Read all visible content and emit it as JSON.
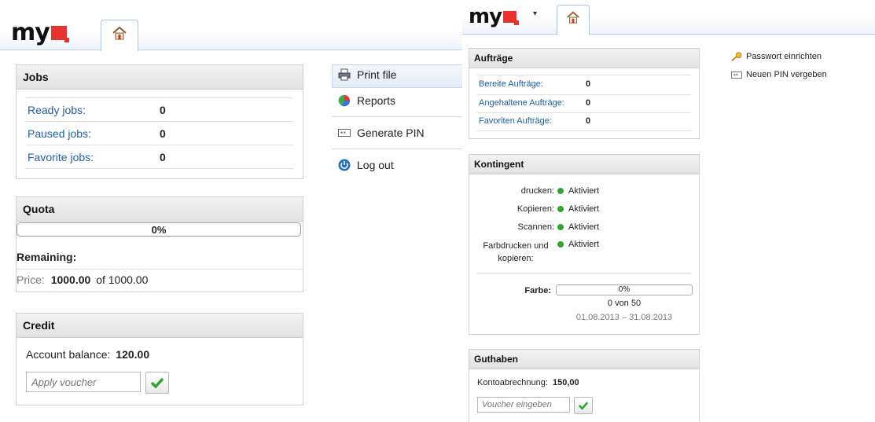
{
  "left": {
    "logo": {
      "text": "my"
    },
    "jobs": {
      "title": "Jobs",
      "rows": [
        {
          "label": "Ready jobs:",
          "value": "0"
        },
        {
          "label": "Paused jobs:",
          "value": "0"
        },
        {
          "label": "Favorite jobs:",
          "value": "0"
        }
      ]
    },
    "quota": {
      "title": "Quota",
      "progress_text": "0%",
      "progress": 0,
      "remaining_label": "Remaining:",
      "price_label": "Price:",
      "price_value": "1000.00",
      "price_of": "of 1000.00"
    },
    "credit": {
      "title": "Credit",
      "balance_label": "Account balance:",
      "balance_value": "120.00",
      "voucher_placeholder": "Apply voucher"
    },
    "menu": {
      "print_file": "Print file",
      "reports": "Reports",
      "generate_pin": "Generate PIN",
      "log_out": "Log out"
    }
  },
  "right": {
    "logo": {
      "text": "my"
    },
    "auftraege": {
      "title": "Aufträge",
      "rows": [
        {
          "label": "Bereite Aufträge:",
          "value": "0"
        },
        {
          "label": "Angehaltene Aufträge:",
          "value": "0"
        },
        {
          "label": "Favoriten Aufträge:",
          "value": "0"
        }
      ]
    },
    "kontingent": {
      "title": "Kontingent",
      "items": [
        {
          "label": "drucken:",
          "status": "Aktiviert"
        },
        {
          "label": "Kopieren:",
          "status": "Aktiviert"
        },
        {
          "label": "Scannen:",
          "status": "Aktiviert"
        },
        {
          "label": "Farbdrucken und kopieren:",
          "status": "Aktiviert"
        }
      ],
      "farbe_label": "Farbe:",
      "farbe_progress_text": "0%",
      "farbe_progress": 0,
      "farbe_count": "0 von 50",
      "farbe_period": "01.08.2013 – 31.08.2013"
    },
    "guthaben": {
      "title": "Guthaben",
      "balance_label": "Kontoabrechnung:",
      "balance_value": "150,00",
      "voucher_placeholder": "Voucher eingeben"
    },
    "links": {
      "password": "Passwort einrichten",
      "pin": "Neuen PIN vergeben"
    }
  },
  "colors": {
    "accent_link": "#1f5fa8",
    "status_green": "#2fa72f",
    "logo_red": "#e8322b"
  }
}
